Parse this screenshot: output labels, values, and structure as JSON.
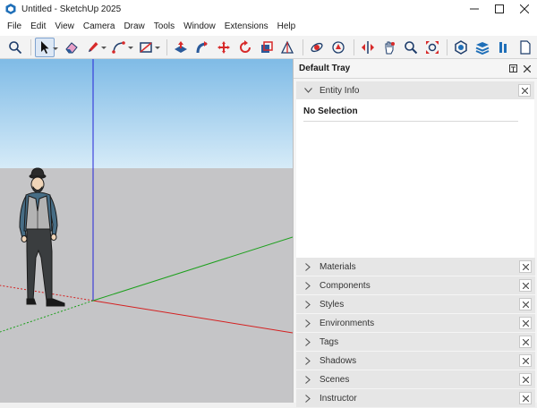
{
  "window": {
    "title": "Untitled - SketchUp 2025",
    "controls": [
      "minimize-icon",
      "maximize-icon",
      "close-icon"
    ]
  },
  "menu": {
    "items": [
      "File",
      "Edit",
      "View",
      "Camera",
      "Draw",
      "Tools",
      "Window",
      "Extensions",
      "Help"
    ]
  },
  "toolbar": {
    "tools": [
      "search-icon",
      "select-icon",
      "eraser-icon",
      "pencil-icon",
      "arc-icon",
      "rectangle-icon",
      "push-pull-icon",
      "follow-me-icon",
      "move-icon",
      "rotate-icon",
      "scale-icon",
      "tape-measure-icon",
      "orbit-icon",
      "pan-icon",
      "flip-icon",
      "hand-icon",
      "zoom-icon",
      "zoom-extents-icon",
      "3d-warehouse-icon",
      "extension-warehouse-icon",
      "layout-icon",
      "file-icon"
    ],
    "accent": "#d72a2a",
    "active_tool": "select-icon"
  },
  "viewport": {
    "sky_top": "#7fbbe6",
    "sky_bottom": "#d6ebf8",
    "ground": "#c5c5c7",
    "axis_red": "#d42020",
    "axis_green": "#1da01d",
    "axis_blue": "#2525d8"
  },
  "tray": {
    "title": "Default Tray",
    "entity_info": {
      "label": "Entity Info",
      "status": "No Selection"
    },
    "panels": [
      {
        "label": "Materials"
      },
      {
        "label": "Components"
      },
      {
        "label": "Styles"
      },
      {
        "label": "Environments"
      },
      {
        "label": "Tags"
      },
      {
        "label": "Shadows"
      },
      {
        "label": "Scenes"
      },
      {
        "label": "Instructor"
      }
    ]
  }
}
